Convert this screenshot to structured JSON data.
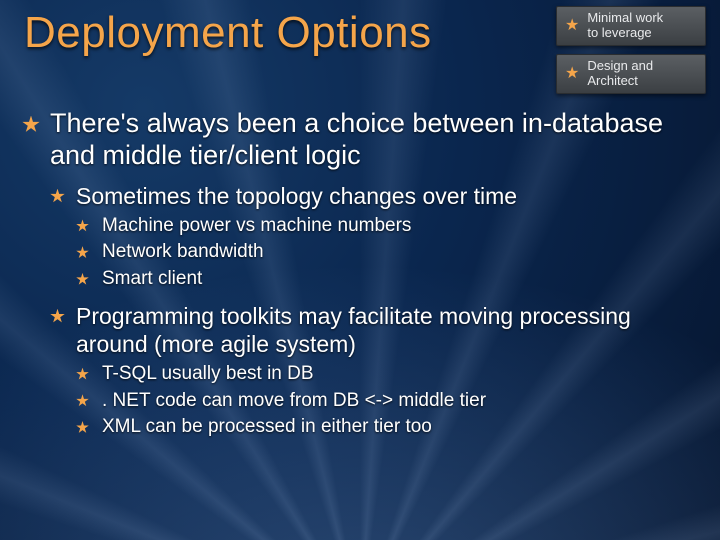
{
  "title": "Deployment Options",
  "badges": [
    {
      "line1": "Minimal work",
      "line2": "to leverage"
    },
    {
      "line1": "Design and",
      "line2": "Architect"
    }
  ],
  "bullets": {
    "l1_0": "There's always been a choice between in-database and middle tier/client logic",
    "l2_0": "Sometimes the topology changes over time",
    "l3_0": "Machine power vs machine numbers",
    "l3_1": "Network bandwidth",
    "l3_2": "Smart client",
    "l2_1": "Programming toolkits may facilitate moving processing around (more agile system)",
    "l3_3": "T-SQL usually best in DB",
    "l3_4": ". NET code can move from DB <-> middle tier",
    "l3_5": "XML can be processed in either tier too"
  }
}
